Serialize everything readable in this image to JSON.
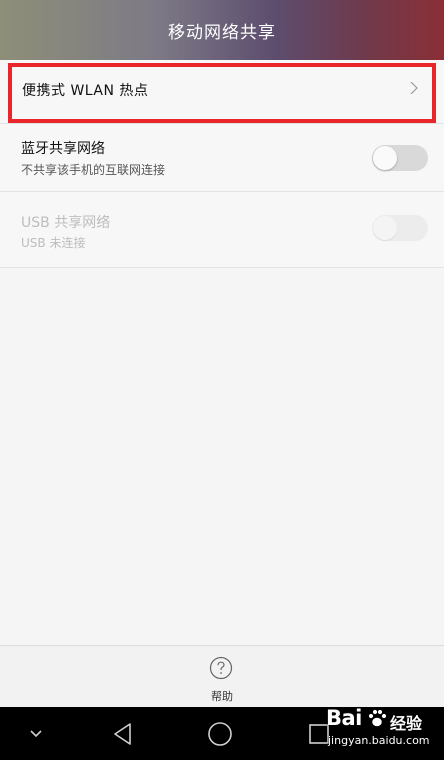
{
  "header": {
    "title": "移动网络共享"
  },
  "hotspot": {
    "label": "便携式 WLAN 热点",
    "icon": "chevron-right-icon",
    "highlight_color": "#e8262c"
  },
  "bluetooth": {
    "title": "蓝牙共享网络",
    "subtitle": "不共享该手机的互联网连接",
    "enabled": false
  },
  "usb": {
    "title": "USB 共享网络",
    "subtitle": "USB 未连接",
    "enabled": false,
    "disabled": true
  },
  "help": {
    "label": "帮助",
    "icon": "help-circle-icon"
  },
  "navbar": {
    "icons": [
      "chevron-down-icon",
      "back-icon",
      "home-icon",
      "recent-apps-icon"
    ]
  },
  "watermark": {
    "logo_left": "Bai",
    "logo_right": "经验",
    "url": "jingyan.baidu.com"
  }
}
